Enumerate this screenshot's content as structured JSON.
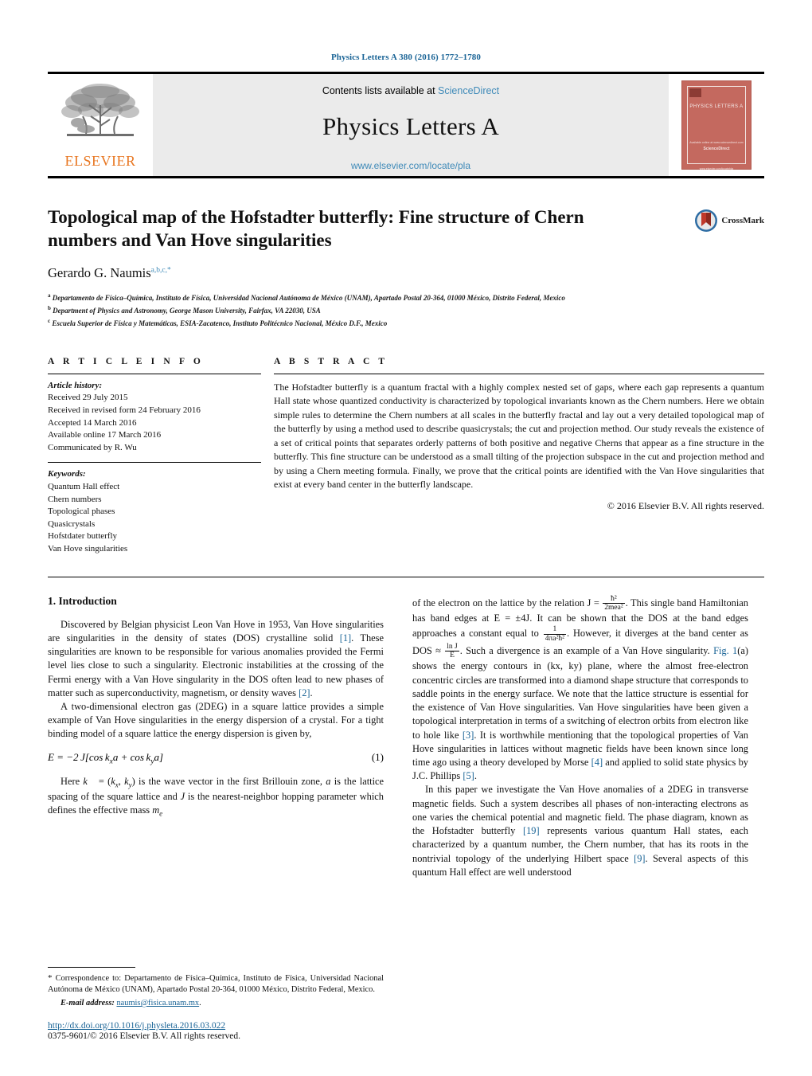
{
  "running_head": "Physics Letters A 380 (2016) 1772–1780",
  "banner": {
    "contents_text": "Contents lists available at ",
    "sciencedirect": "ScienceDirect",
    "journal_title": "Physics Letters A",
    "journal_url": "www.elsevier.com/locate/pla",
    "publisher_wordmark": "ELSEVIER",
    "publisher_color": "#E87722",
    "cover": {
      "title": "PHYSICS LETTERS A",
      "footer_line1": "Available online at www.sciencedirect.com",
      "footer_line2": "ScienceDirect",
      "footer_line3": "www.elsevier.com/locate/pla",
      "color": "#c4695f"
    }
  },
  "article": {
    "title": "Topological map of the Hofstadter butterfly: Fine structure of Chern numbers and Van Hove singularities",
    "crossmark_label": "CrossMark",
    "author": "Gerardo G. Naumis",
    "author_marks": "a,b,c,",
    "author_corresponding_mark": "*",
    "affiliations": [
      {
        "mark": "a",
        "text": "Departamento de Física–Química, Instituto de Física, Universidad Nacional Autónoma de México (UNAM), Apartado Postal 20-364, 01000 México, Distrito Federal, Mexico"
      },
      {
        "mark": "b",
        "text": "Department of Physics and Astronomy, George Mason University, Fairfax, VA 22030, USA"
      },
      {
        "mark": "c",
        "text": "Escuela Superior de Física y Matemáticas, ESIA-Zacatenco, Instituto Politécnico Nacional, México D.F., Mexico"
      }
    ]
  },
  "article_info": {
    "heading": "A R T I C L E    I N F O",
    "history_label": "Article history:",
    "history": [
      "Received 29 July 2015",
      "Received in revised form 24 February 2016",
      "Accepted 14 March 2016",
      "Available online 17 March 2016",
      "Communicated by R. Wu"
    ],
    "keywords_label": "Keywords:",
    "keywords": [
      "Quantum Hall effect",
      "Chern numbers",
      "Topological phases",
      "Quasicrystals",
      "Hofstdater butterfly",
      "Van Hove singularities"
    ]
  },
  "abstract": {
    "heading": "A B S T R A C T",
    "body": "The Hofstadter butterfly is a quantum fractal with a highly complex nested set of gaps, where each gap represents a quantum Hall state whose quantized conductivity is characterized by topological invariants known as the Chern numbers. Here we obtain simple rules to determine the Chern numbers at all scales in the butterfly fractal and lay out a very detailed topological map of the butterfly by using a method used to describe quasicrystals; the cut and projection method. Our study reveals the existence of a set of critical points that separates orderly patterns of both positive and negative Cherns that appear as a fine structure in the butterfly. This fine structure can be understood as a small tilting of the projection subspace in the cut and projection method and by using a Chern meeting formula. Finally, we prove that the critical points are identified with the Van Hove singularities that exist at every band center in the butterfly landscape.",
    "copyright": "© 2016 Elsevier B.V. All rights reserved."
  },
  "body": {
    "section_heading": "1. Introduction",
    "left": {
      "p1_a": "Discovered by Belgian physicist Leon Van Hove in 1953, Van Hove singularities are singularities in the density of states (DOS) crystalline solid ",
      "p1_ref1": "[1]",
      "p1_b": ". These singularities are known to be responsible for various anomalies provided the Fermi level lies close to such a singularity. Electronic instabilities at the crossing of the Fermi energy with a Van Hove singularity in the DOS often lead to new phases of matter such as superconductivity, magnetism, or density waves ",
      "p1_ref2": "[2]",
      "p1_c": ".",
      "p2": "A two-dimensional electron gas (2DEG) in a square lattice provides a simple example of Van Hove singularities in the energy dispersion of a crystal. For a tight binding model of a square lattice the energy dispersion is given by,",
      "eq1_text": "E = −2 J[cos kxa + cos kya]",
      "eq1_num": "(1)",
      "p3": "Here k⃗ = (kx, ky) is the wave vector in the first Brillouin zone, a is the lattice spacing of the square lattice and J is the nearest-neighbor hopping parameter which defines the effective mass me"
    },
    "right": {
      "p1_a": "of the electron on the lattice by the relation J = ",
      "p1_frac1_num": "ħ²",
      "p1_frac1_den": "2mea²",
      "p1_b": ". This single band Hamiltonian has band edges at E = ±4J. It can be shown that the DOS at the band edges approaches a constant equal to ",
      "p1_frac2_num": "1",
      "p1_frac2_den": "4πa²ħ²",
      "p1_c": ". However, it diverges at the band center as DOS ≈ ",
      "p1_frac3_num": "ln J",
      "p1_frac3_den": "E",
      "p1_d": ". Such a divergence is an example of a Van Hove singularity. ",
      "p1_figref": "Fig. 1",
      "p1_e": "(a) shows the energy contours in (kx, ky) plane, where the almost free-electron concentric circles are transformed into a diamond shape structure that corresponds to saddle points in the energy surface. We note that the lattice structure is essential for the existence of Van Hove singularities. Van Hove singularities have been given a topological interpretation in terms of a switching of electron orbits from electron like to hole like ",
      "p1_ref3": "[3]",
      "p1_f": ". It is worthwhile mentioning that the topological properties of Van Hove singularities in lattices without magnetic fields have been known since long time ago using a theory developed by Morse ",
      "p1_ref4": "[4]",
      "p1_g": " and applied to solid state physics by J.C. Phillips ",
      "p1_ref5": "[5]",
      "p1_h": ".",
      "p2_a": "In this paper we investigate the Van Hove anomalies of a 2DEG in transverse magnetic fields. Such a system describes all phases of non-interacting electrons as one varies the chemical potential and magnetic field. The phase diagram, known as the Hofstadter butterfly ",
      "p2_ref19": "[19]",
      "p2_b": " represents various quantum Hall states, each characterized by a quantum number, the Chern number, that has its roots in the nontrivial topology of the underlying Hilbert space ",
      "p2_ref9": "[9]",
      "p2_c": ". Several aspects of this quantum Hall effect are well understood"
    }
  },
  "footnote": {
    "star": "*",
    "correspondence": " Correspondence to: Departamento de Física–Química, Instituto de Física, Universidad Nacional Autónoma de México (UNAM), Apartado Postal 20-364, 01000 México, Distrito Federal, Mexico.",
    "email_label": "E-mail address:",
    "email": "naumis@fisica.unam.mx",
    "email_tail": ".",
    "doi": "http://dx.doi.org/10.1016/j.physleta.2016.03.022",
    "issn_line": "0375-9601/© 2016 Elsevier B.V. All rights reserved."
  },
  "colors": {
    "link": "#1a6496",
    "sciencedirect": "#3f8ab8",
    "elsevier_orange": "#E87722",
    "banner_bg": "#ebebeb"
  }
}
